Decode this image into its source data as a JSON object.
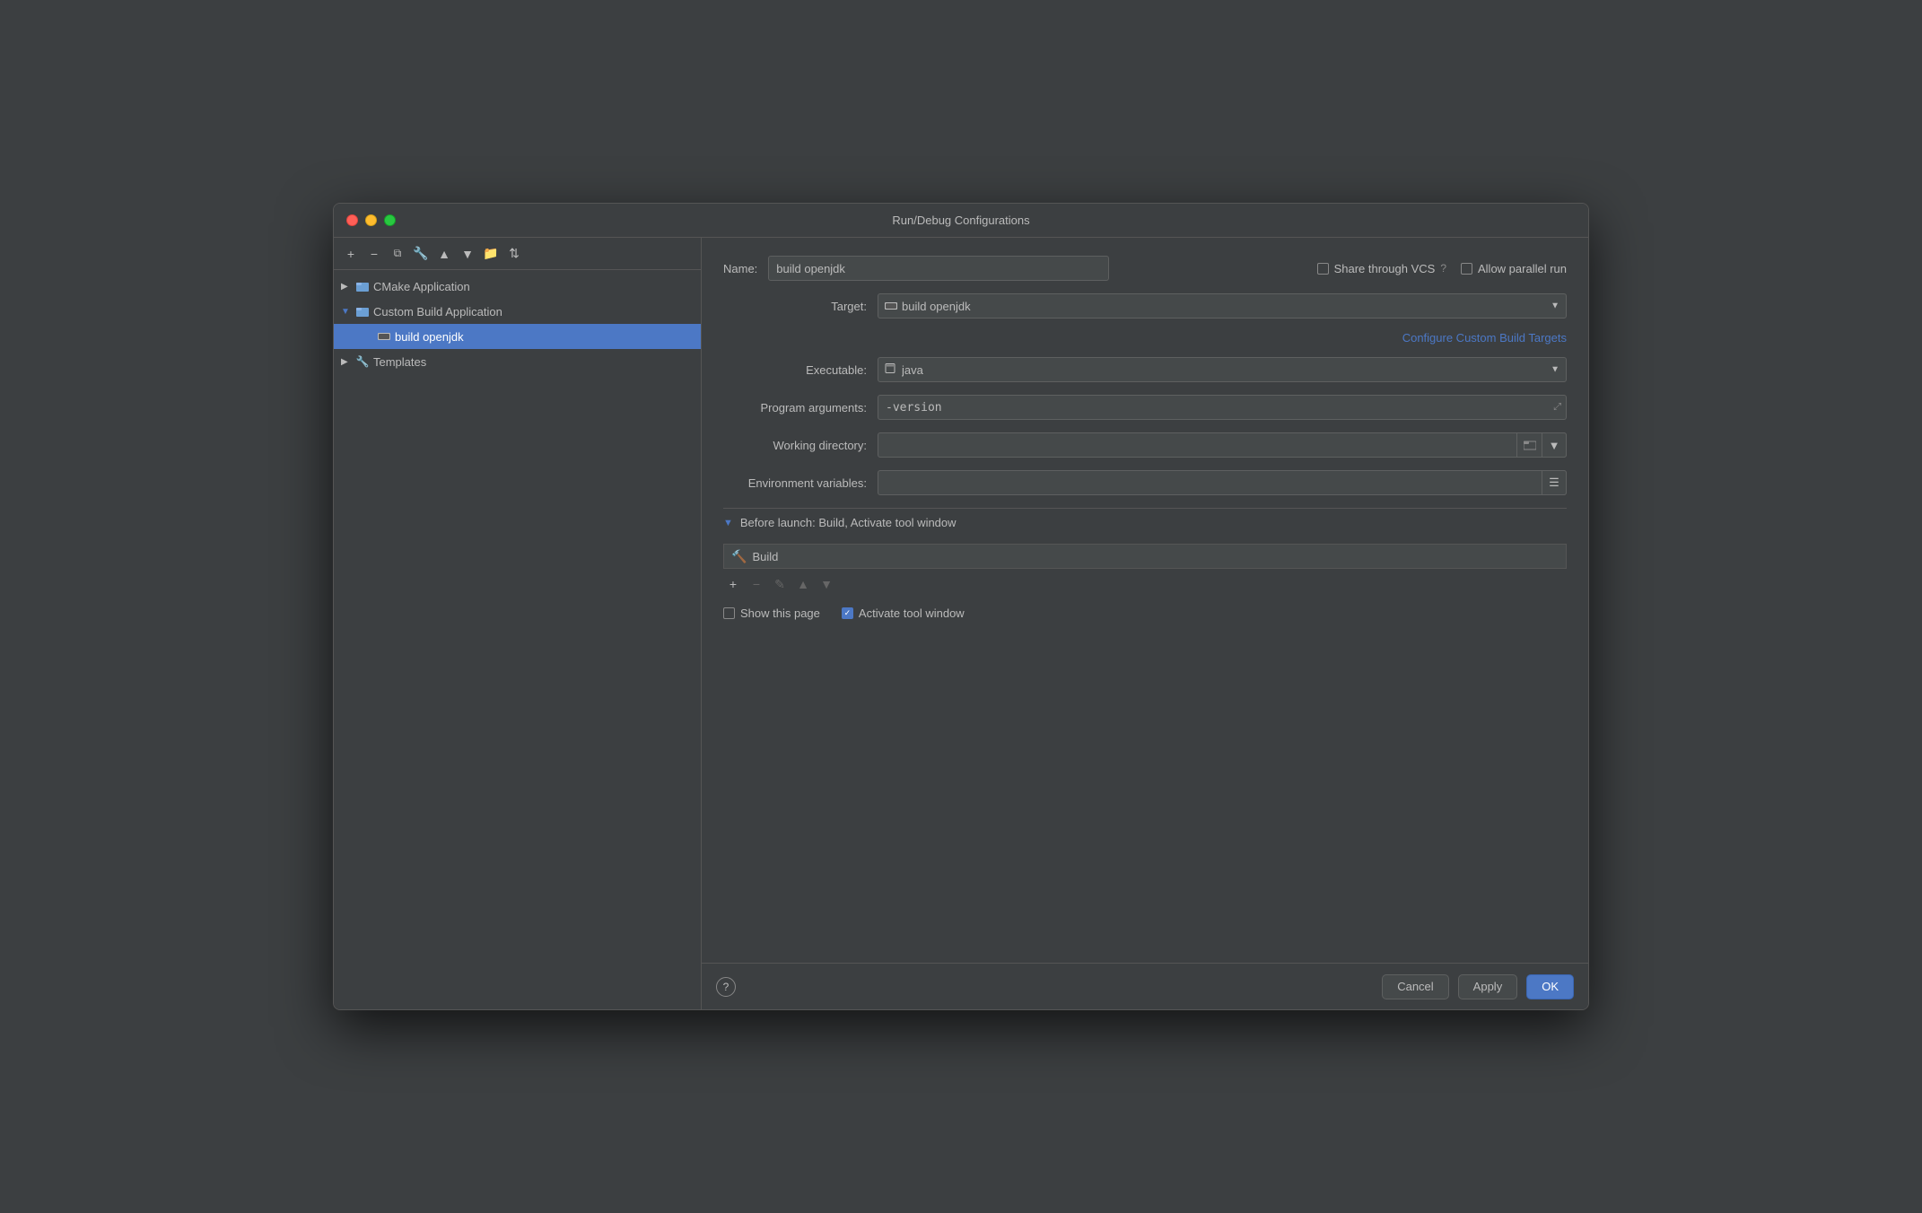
{
  "window": {
    "title": "Run/Debug Configurations"
  },
  "sidebar": {
    "toolbar": {
      "add_label": "+",
      "remove_label": "−",
      "copy_label": "⧉",
      "wrench_label": "🔧",
      "up_label": "▲",
      "down_label": "▼",
      "folder_label": "📁",
      "sort_label": "⇅"
    },
    "items": [
      {
        "id": "cmake",
        "label": "CMake Application",
        "level": 0,
        "hasChevron": true,
        "chevronOpen": false,
        "selected": false
      },
      {
        "id": "custom-build",
        "label": "Custom Build Application",
        "level": 0,
        "hasChevron": true,
        "chevronOpen": true,
        "selected": false
      },
      {
        "id": "build-openjdk",
        "label": "build openjdk",
        "level": 2,
        "hasChevron": false,
        "selected": true
      },
      {
        "id": "templates",
        "label": "Templates",
        "level": 0,
        "hasChevron": true,
        "chevronOpen": false,
        "selected": false
      }
    ]
  },
  "form": {
    "name_label": "Name:",
    "name_value": "build openjdk",
    "share_vcs_label": "Share through VCS",
    "allow_parallel_label": "Allow parallel run",
    "target_label": "Target:",
    "target_value": "build openjdk",
    "configure_link": "Configure Custom Build Targets",
    "executable_label": "Executable:",
    "executable_value": "java",
    "program_args_label": "Program arguments:",
    "program_args_value": "-version",
    "working_dir_label": "Working directory:",
    "working_dir_value": "",
    "env_vars_label": "Environment variables:",
    "env_vars_value": "",
    "before_launch_label": "Before launch: Build, Activate tool window",
    "build_item_label": "Build",
    "show_this_page_label": "Show this page",
    "activate_tool_window_label": "Activate tool window",
    "show_checked": false,
    "activate_checked": true
  },
  "footer": {
    "cancel_label": "Cancel",
    "apply_label": "Apply",
    "ok_label": "OK"
  }
}
